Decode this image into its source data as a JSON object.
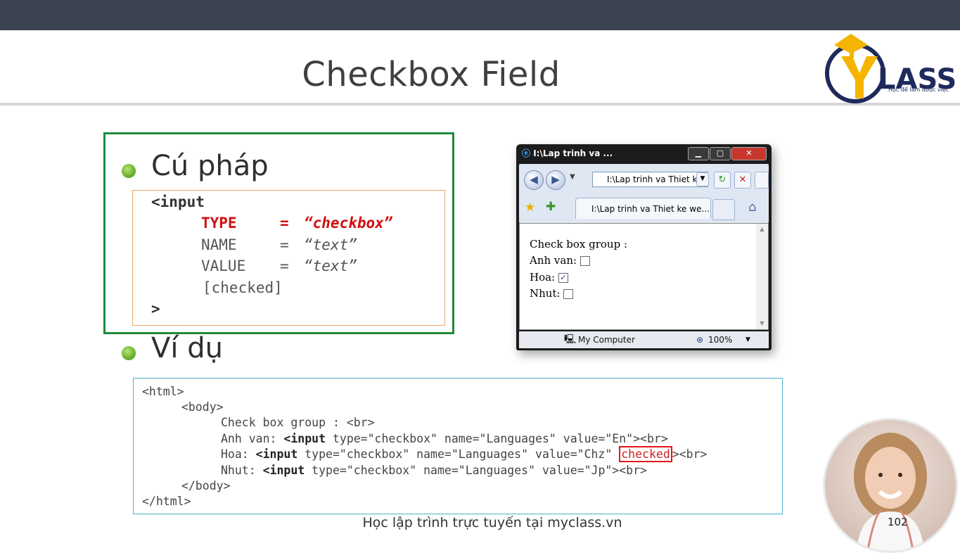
{
  "slide": {
    "title": "Checkbox Field",
    "footer": "Học lập trình trực tuyến tại myclass.vn",
    "page_number": "102"
  },
  "logo": {
    "text": "MYLASS",
    "tagline": "Học để làm được việc"
  },
  "syntax": {
    "heading": "Cú pháp",
    "open": "<input",
    "type_key": "TYPE",
    "type_eq": "=",
    "type_val": "“checkbox”",
    "name_key": "NAME",
    "name_eq": "=",
    "name_val": "“text”",
    "value_key": "VALUE",
    "value_eq": "=",
    "value_val": "“text”",
    "checked": "[checked]",
    "close": ">"
  },
  "example": {
    "heading": "Ví dụ",
    "l1": "<html>",
    "l2": "<body>",
    "l3": "Check box group : <br>",
    "l4_a": "Anh van: ",
    "l4_b": "<input",
    "l4_c": " type=\"checkbox\" name=\"Languages\" value=\"En\"><br>",
    "l5_a": "Hoa: ",
    "l5_b": "<input",
    "l5_c": " type=\"checkbox\" name=\"Languages\" value=\"Chz\" ",
    "l5_d": "checked",
    "l5_e": "><br>",
    "l6_a": "Nhut: ",
    "l6_b": "<input",
    "l6_c": " type=\"checkbox\" name=\"Languages\" value=\"Jp\"><br>",
    "l7": "</body>",
    "l8": "</html>"
  },
  "browser": {
    "title": "I:\\Lap trinh va ...",
    "address": "I:\\Lap trinh va Thiet k",
    "tab": "I:\\Lap trinh va Thiet ke we...",
    "content_heading": "Check box group :",
    "items": [
      {
        "label": "Anh van:",
        "checked": false
      },
      {
        "label": "Hoa:",
        "checked": true
      },
      {
        "label": "Nhut:",
        "checked": false
      }
    ],
    "status_zone": "My Computer",
    "zoom": "100%"
  }
}
